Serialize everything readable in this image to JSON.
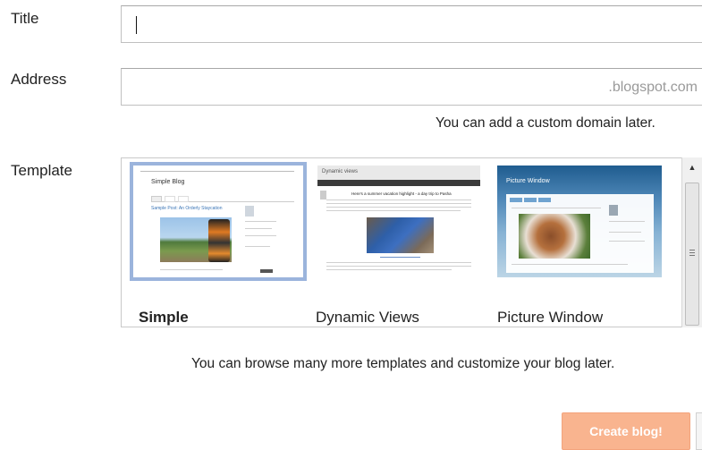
{
  "form": {
    "title_label": "Title",
    "title_value": "",
    "address_label": "Address",
    "address_value": "",
    "address_suffix": ".blogspot.com",
    "address_hint": "You can add a custom domain later.",
    "template_label": "Template",
    "templates": [
      {
        "name": "Simple",
        "selected": true,
        "preview": {
          "blog_title": "Simple Blog",
          "post_title": "Sample Post: An Orderly Staycation"
        }
      },
      {
        "name": "Dynamic Views",
        "selected": false,
        "preview": {
          "header": "Dynamic views",
          "post_title": "Here's a summer vacation highlight - a day trip to Pasha"
        }
      },
      {
        "name": "Picture Window",
        "selected": false,
        "preview": {
          "header": "Picture Window"
        }
      }
    ],
    "template_hint": "You can browse many more templates and customize your blog later.",
    "create_button": "Create blog!"
  },
  "colors": {
    "create_button_bg": "#f9b48f",
    "selected_outline": "#9bb4dc"
  }
}
